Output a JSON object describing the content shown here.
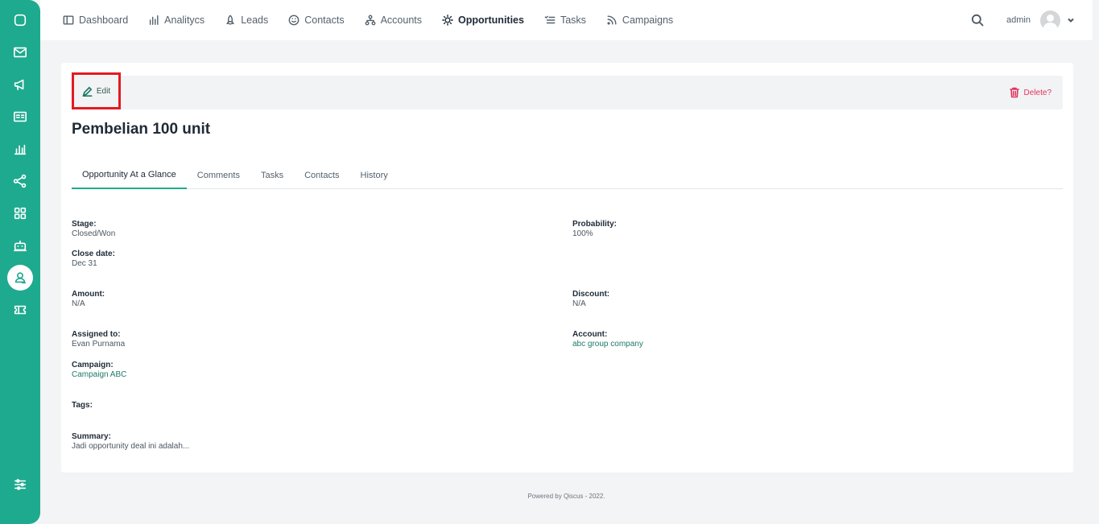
{
  "sidebar": {
    "items": [
      {
        "name": "chat",
        "icon": "chat-bubble-icon"
      },
      {
        "name": "inbox",
        "icon": "envelope-icon"
      },
      {
        "name": "broadcast",
        "icon": "megaphone-icon"
      },
      {
        "name": "contacts-card",
        "icon": "id-card-icon"
      },
      {
        "name": "analytics",
        "icon": "bar-chart-icon"
      },
      {
        "name": "integrations",
        "icon": "share-nodes-icon"
      },
      {
        "name": "apps",
        "icon": "grid-icon"
      },
      {
        "name": "bot",
        "icon": "robot-icon"
      },
      {
        "name": "crm",
        "icon": "user-icon",
        "active": true
      },
      {
        "name": "tickets",
        "icon": "ticket-icon"
      },
      {
        "name": "settings",
        "icon": "sliders-icon"
      }
    ]
  },
  "nav": {
    "items": [
      {
        "label": "Dashboard",
        "icon": "dashboard-icon"
      },
      {
        "label": "Analitycs",
        "icon": "bar-chart-icon"
      },
      {
        "label": "Leads",
        "icon": "rocket-icon"
      },
      {
        "label": "Contacts",
        "icon": "smiley-icon"
      },
      {
        "label": "Accounts",
        "icon": "org-chart-icon"
      },
      {
        "label": "Opportunities",
        "icon": "sun-icon",
        "active": true
      },
      {
        "label": "Tasks",
        "icon": "checklist-icon"
      },
      {
        "label": "Campaigns",
        "icon": "rss-icon"
      }
    ]
  },
  "user": {
    "name": "admin"
  },
  "actions": {
    "edit_label": "Edit",
    "delete_label": "Delete?"
  },
  "opportunity": {
    "title": "Pembelian 100 unit",
    "tabs": [
      "Opportunity At a Glance",
      "Comments",
      "Tasks",
      "Contacts",
      "History"
    ],
    "fields": {
      "stage": {
        "label": "Stage:",
        "value": "Closed/Won"
      },
      "probability": {
        "label": "Probability:",
        "value": "100%"
      },
      "close_date": {
        "label": "Close date:",
        "value": "Dec 31"
      },
      "amount": {
        "label": "Amount:",
        "value": "N/A"
      },
      "discount": {
        "label": "Discount:",
        "value": "N/A"
      },
      "assigned_to": {
        "label": "Assigned to:",
        "value": "Evan Purnama"
      },
      "account": {
        "label": "Account:",
        "value": "abc group company"
      },
      "campaign": {
        "label": "Campaign:",
        "value": "Campaign ABC"
      },
      "tags": {
        "label": "Tags:",
        "value": ""
      },
      "summary": {
        "label": "Summary:",
        "value": "Jadi opportunity deal ini adalah..."
      }
    }
  },
  "footer": {
    "text": "Powered by Qiscus - 2022."
  },
  "colors": {
    "brand": "#1eaa8e",
    "delete": "#e0345f",
    "highlight": "#e11b22"
  }
}
